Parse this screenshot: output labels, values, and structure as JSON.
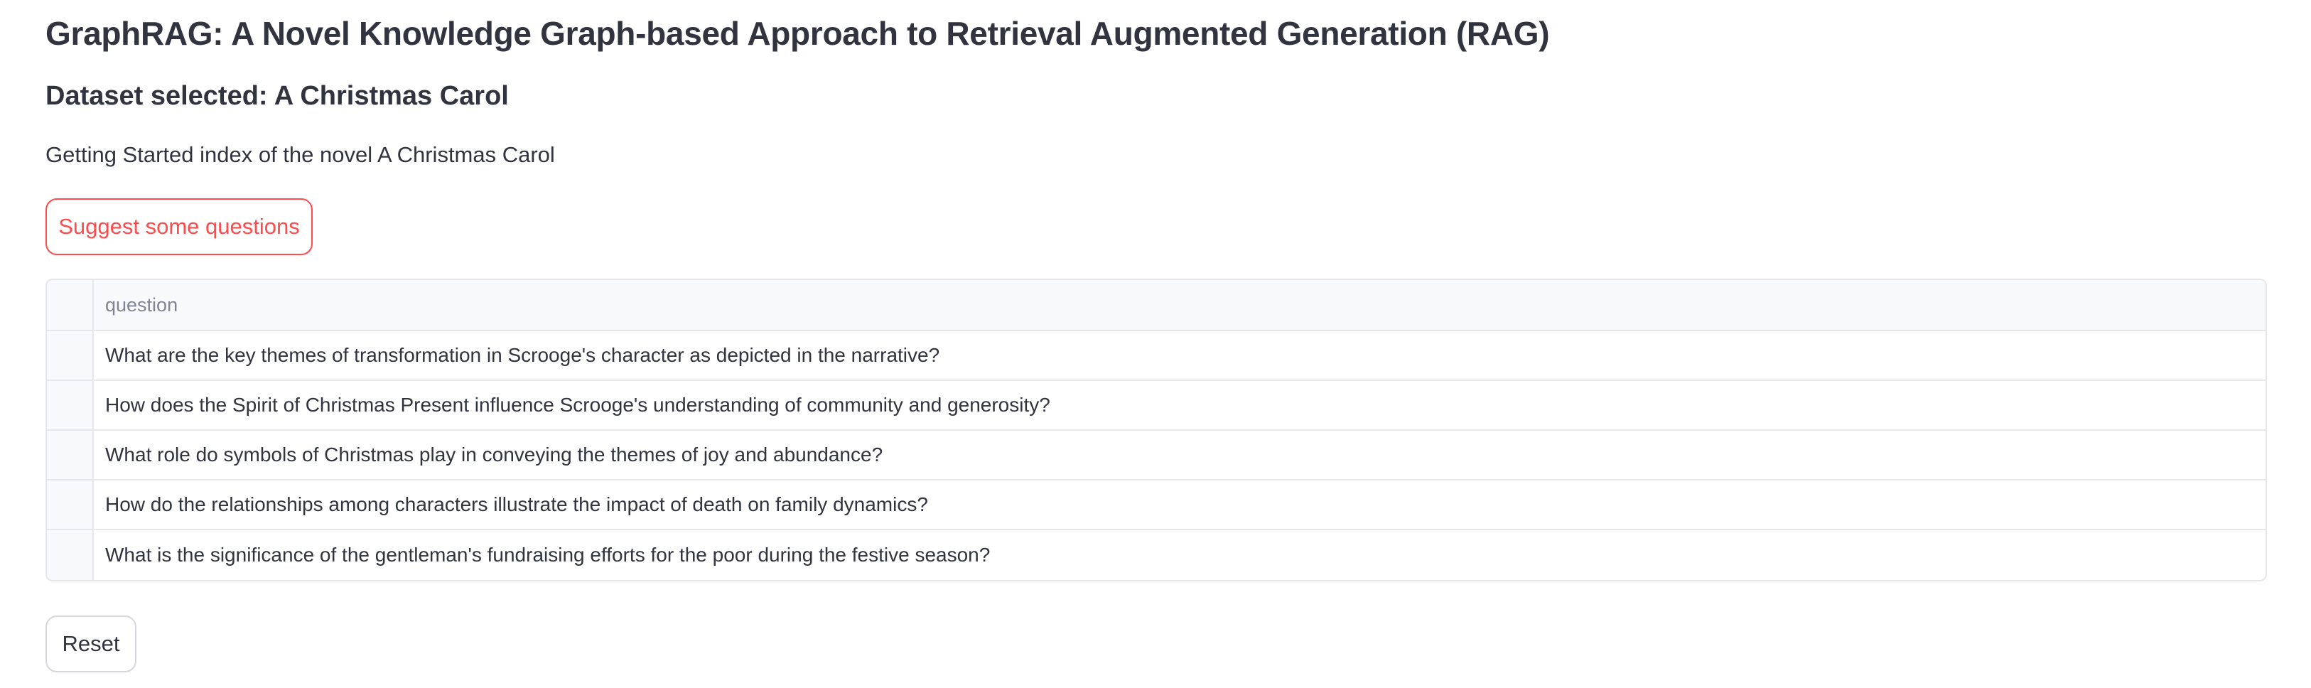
{
  "header": {
    "title": "GraphRAG: A Novel Knowledge Graph-based Approach to Retrieval Augmented Generation (RAG)",
    "dataset_heading": "Dataset selected: A Christmas Carol",
    "description": "Getting Started index of the novel A Christmas Carol"
  },
  "actions": {
    "suggest_label": "Suggest some questions",
    "reset_label": "Reset"
  },
  "table": {
    "column_header": "question",
    "rows": [
      "What are the key themes of transformation in Scrooge's character as depicted in the narrative?",
      "How does the Spirit of Christmas Present influence Scrooge's understanding of community and generosity?",
      "What role do symbols of Christmas play in conveying the themes of joy and abundance?",
      "How do the relationships among characters illustrate the impact of death on family dynamics?",
      "What is the significance of the gentleman's fundraising efforts for the poor during the festive season?"
    ]
  },
  "colors": {
    "accent": "#ff4b4b",
    "text": "#31333f",
    "border": "#e6e7eb",
    "header_bg": "#f8f9fb"
  }
}
